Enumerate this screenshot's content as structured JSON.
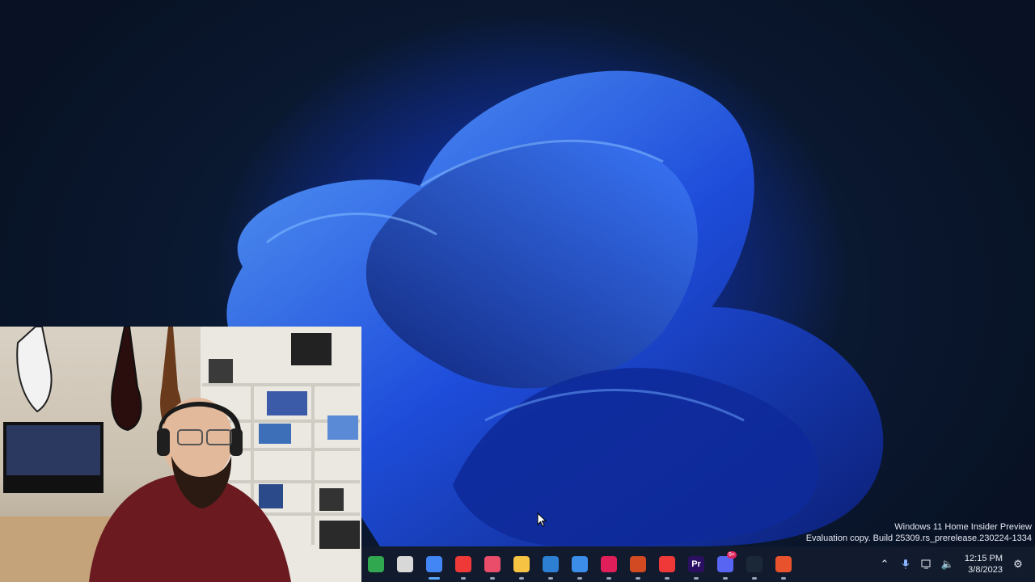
{
  "watermark": {
    "line1": "Windows 11 Home Insider Preview",
    "line2": "Evaluation copy. Build 25309.rs_prerelease.230224-1334"
  },
  "taskbar": {
    "apps": [
      {
        "name": "widgets",
        "icon": "widgets-icon",
        "color": "#2fa84f"
      },
      {
        "name": "task-view",
        "icon": "task-view-icon",
        "color": "#d8d8d8"
      },
      {
        "name": "chrome",
        "icon": "chrome-icon",
        "color": "#4285f4",
        "active": true
      },
      {
        "name": "vivaldi",
        "icon": "vivaldi-icon",
        "color": "#ef3939"
      },
      {
        "name": "snipping-tool",
        "icon": "snip-icon",
        "color": "#e94d6a"
      },
      {
        "name": "file-explorer",
        "icon": "folder-icon",
        "color": "#f6c343"
      },
      {
        "name": "blue-app",
        "icon": "blue-icon",
        "color": "#2d7fd3"
      },
      {
        "name": "todo",
        "icon": "check-icon",
        "color": "#3b8de8"
      },
      {
        "name": "slack",
        "icon": "slack-icon",
        "color": "#e01e5a"
      },
      {
        "name": "obs",
        "icon": "record-icon",
        "color": "#d14a22"
      },
      {
        "name": "vivaldi-2",
        "icon": "vivaldi-icon",
        "color": "#ef3939"
      },
      {
        "name": "premiere",
        "icon": "premiere-icon",
        "color": "#2a0f63",
        "label": "Pr"
      },
      {
        "name": "discord",
        "icon": "discord-icon",
        "color": "#5865f2",
        "badge": "9+"
      },
      {
        "name": "steam",
        "icon": "steam-icon",
        "color": "#1b2838"
      },
      {
        "name": "app-orange",
        "icon": "orange-app-icon",
        "color": "#e8532e"
      }
    ]
  },
  "tray": {
    "time": "12:15 PM",
    "date": "3/8/2023"
  }
}
